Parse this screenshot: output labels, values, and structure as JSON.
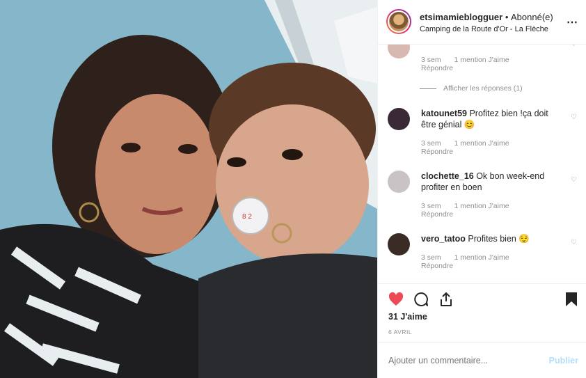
{
  "post": {
    "username": "etsimamieblogguer",
    "separator": "•",
    "follow_status": "Abonné(e)",
    "location": "Camping de la Route d'Or - La Flèche",
    "more_icon": "more-icon"
  },
  "comments": [
    {
      "username": "",
      "text": "",
      "time": "3 sem",
      "likes": "1 mention J'aime",
      "reply_label": "Répondre",
      "avatar_color": "#d8b8b0"
    },
    {
      "username": "katounet59",
      "text": " Profitez bien !ça doit être génial 😊",
      "time": "3 sem",
      "likes": "1 mention J'aime",
      "reply_label": "Répondre",
      "avatar_color": "#3a2a38"
    },
    {
      "username": "clochette_16",
      "text": " Ok bon week-end profiter en boen",
      "time": "3 sem",
      "likes": "1 mention J'aime",
      "reply_label": "Répondre",
      "avatar_color": "#c9c3c5"
    },
    {
      "username": "vero_tatoo",
      "text": " Profites bien 😌",
      "time": "3 sem",
      "likes": "1 mention J'aime",
      "reply_label": "Répondre",
      "avatar_color": "#3b2b25"
    }
  ],
  "view_replies": "Afficher les réponses (1)",
  "actions": {
    "like_icon": "heart-filled-icon",
    "comment_icon": "comment-icon",
    "share_icon": "share-icon",
    "save_icon": "bookmark-icon",
    "like_color": "#ed4956"
  },
  "likes_count": "31 J'aime",
  "date": "6 AVRIL",
  "add_comment": {
    "placeholder": "Ajouter un commentaire...",
    "publish_label": "Publier"
  }
}
